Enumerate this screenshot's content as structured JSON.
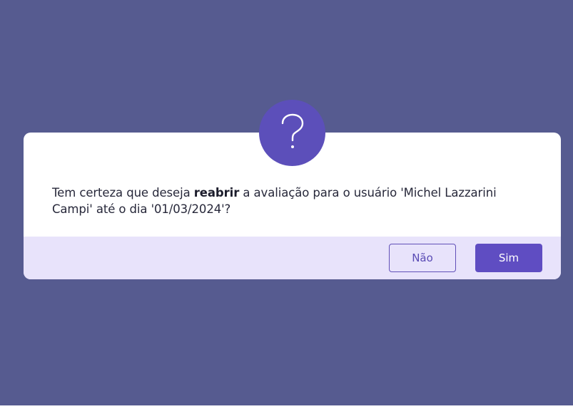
{
  "dialog": {
    "badge_icon": "question-mark-icon",
    "message_prefix": "Tem certeza que deseja ",
    "message_bold": "reabrir",
    "message_suffix": " a avaliação para o usuário 'Michel Lazzarini Campi' até o dia '01/03/2024'?",
    "buttons": {
      "no_label": "Não",
      "yes_label": "Sim"
    }
  },
  "colors": {
    "overlay": "#565b90",
    "accent": "#5f4dc2",
    "footer": "#e8e3fb"
  }
}
